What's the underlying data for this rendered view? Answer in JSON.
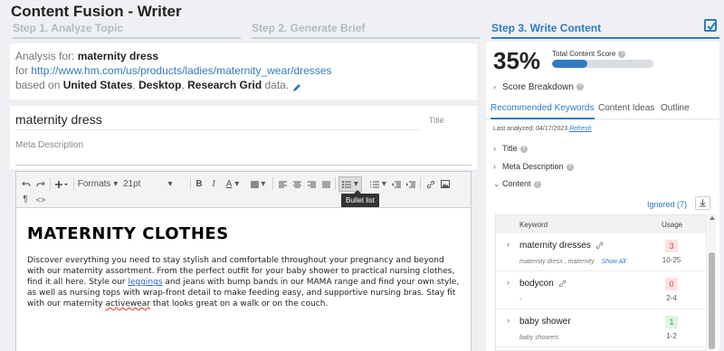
{
  "app": {
    "title": "Content Fusion - Writer"
  },
  "steps": [
    {
      "label": "Step 1. Analyze Topic"
    },
    {
      "label": "Step 2. Generate Brief"
    },
    {
      "label": "Step 3. Write Content"
    }
  ],
  "analysis": {
    "prefix": "Analysis for:",
    "topic": "maternity dress",
    "for_label": "for",
    "url": "http://www.hm.com/us/products/ladies/maternity_wear/dresses",
    "based_label": "based on",
    "country": "United States",
    "device": "Desktop",
    "source": "Research Grid",
    "suffix": "data."
  },
  "title_field": {
    "value": "maternity dress",
    "label": "Title"
  },
  "meta_field": {
    "placeholder": "Meta Description"
  },
  "toolbar": {
    "formats_label": "Formats",
    "font_size": "21pt",
    "tooltip": "Bullet list",
    "icons": [
      "undo-icon",
      "redo-icon",
      "insert-icon",
      "bold-icon",
      "italic-icon",
      "font-color-icon",
      "highlight-icon",
      "align-left-icon",
      "align-center-icon",
      "align-right-icon",
      "justify-icon",
      "bullet-list-icon",
      "numbered-list-icon",
      "outdent-icon",
      "indent-icon",
      "link-icon",
      "image-icon",
      "paragraph-icon",
      "source-code-icon"
    ]
  },
  "document": {
    "heading": "MATERNITY CLOTHES",
    "p_part1": "Discover everything you need to stay stylish and comfortable throughout your pregnancy and beyond with our maternity assortment. From the perfect outfit for your baby shower to practical nursing clothes, find it all here. Style our ",
    "p_link": "leggings",
    "p_part2": " and jeans with bump bands in our MAMA range and find your own style, as well as nursing tops with wrap-front detail to make feeding easy, and supportive nursing bras. Stay fit with our maternity ",
    "p_spell": "activewear",
    "p_part3": " that looks great on a walk or on the couch."
  },
  "score": {
    "value_text": "35%",
    "value": 35,
    "label": "Total Content Score",
    "breakdown_label": "Score Breakdown"
  },
  "tabs": [
    {
      "label": "Recommended Keywords",
      "active": true
    },
    {
      "label": "Content Ideas",
      "active": false
    },
    {
      "label": "Outline",
      "active": false
    }
  ],
  "analyzed": {
    "label": "Last analyzed: 04/17/2023",
    "refresh": "Refresh"
  },
  "sections": {
    "title": "Title",
    "meta": "Meta Description",
    "content": "Content"
  },
  "ignored_label": "Ignored (7)",
  "keyword_table": {
    "col_keyword": "Keyword",
    "col_usage": "Usage",
    "rows": [
      {
        "keyword": "maternity dresses",
        "variants": "maternity dress ,  maternity",
        "show_all": "Show All",
        "count": "3",
        "range": "10-25",
        "status": "red"
      },
      {
        "keyword": "bodycon",
        "variants": "-",
        "show_all": "",
        "count": "0",
        "range": "2-4",
        "status": "red"
      },
      {
        "keyword": "baby shower",
        "variants": "baby showers",
        "show_all": "",
        "count": "1",
        "range": "1-2",
        "status": "green"
      }
    ]
  },
  "colors": {
    "accent": "#2f7bbf",
    "bad": "#d44444",
    "good": "#3a9a3a"
  }
}
